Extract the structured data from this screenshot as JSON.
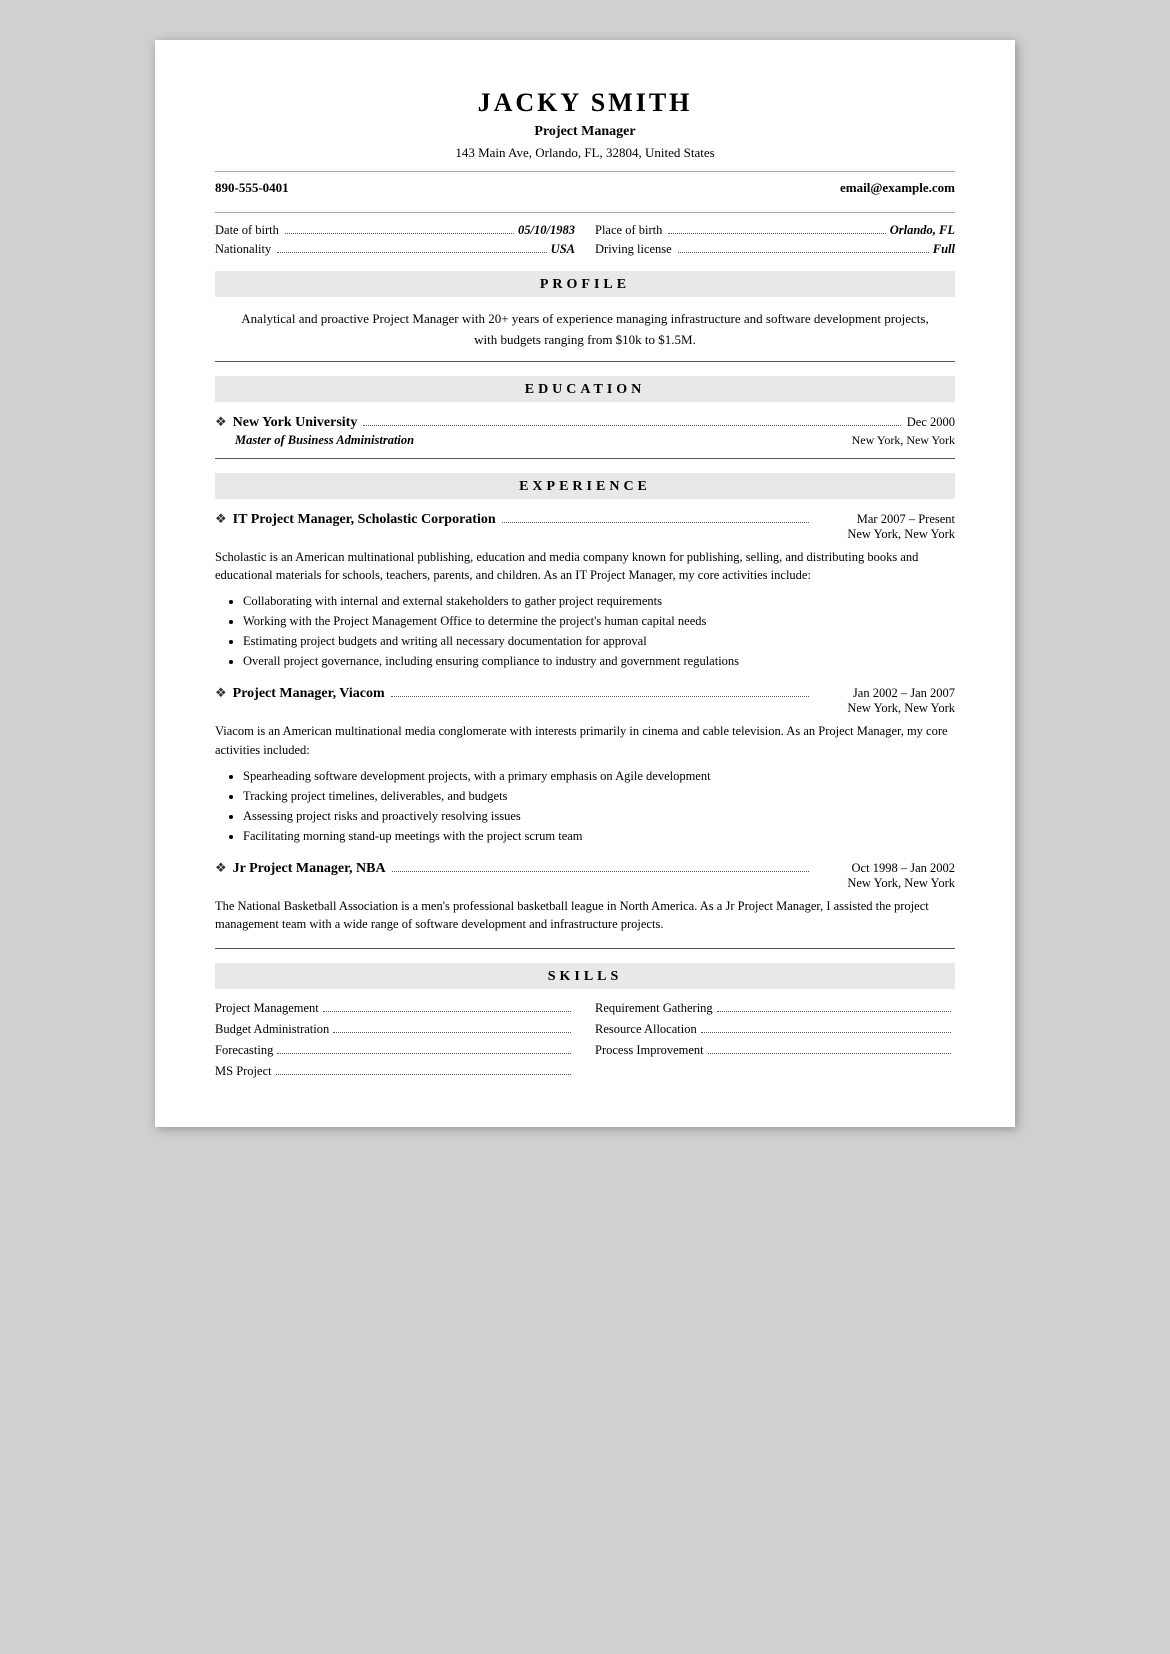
{
  "header": {
    "name": "JACKY SMITH",
    "title": "Project Manager",
    "address": "143 Main Ave, Orlando, FL, 32804, United States",
    "phone": "890-555-0401",
    "email": "email@example.com"
  },
  "personal_info": {
    "dob_label": "Date of birth",
    "dob_value": "05/10/1983",
    "pob_label": "Place of birth",
    "pob_value": "Orlando, FL",
    "nationality_label": "Nationality",
    "nationality_value": "USA",
    "license_label": "Driving license",
    "license_value": "Full"
  },
  "sections": {
    "profile": "PROFILE",
    "profile_text": "Analytical and proactive Project Manager with 20+ years of experience managing infrastructure and software development projects, with budgets ranging from $10k to $1.5M.",
    "education": "EDUCATION",
    "experience": "EXPERIENCE",
    "skills": "SKILLS"
  },
  "education": [
    {
      "school": "New York University",
      "degree": "Master of Business Administration",
      "date": "Dec 2000",
      "location": "New York, New York"
    }
  ],
  "experience": [
    {
      "title": "IT Project Manager, Scholastic Corporation",
      "date": "Mar 2007 – Present",
      "location": "New York, New York",
      "description": "Scholastic is an American multinational publishing, education and media company known for publishing, selling, and distributing books and educational materials for schools, teachers, parents, and children. As an IT Project Manager, my core activities include:",
      "bullets": [
        "Collaborating with internal and external stakeholders to gather project requirements",
        "Working with the Project Management Office to determine the project's human capital needs",
        "Estimating project budgets and writing all necessary documentation for approval",
        "Overall project governance, including ensuring compliance to industry and government regulations"
      ]
    },
    {
      "title": "Project Manager, Viacom",
      "date": "Jan 2002 – Jan 2007",
      "location": "New York, New York",
      "description": "Viacom is an American multinational media conglomerate with interests primarily in cinema and cable television. As an Project Manager, my core activities included:",
      "bullets": [
        "Spearheading software development projects, with a primary emphasis on Agile development",
        "Tracking project timelines, deliverables, and budgets",
        "Assessing project risks and proactively resolving issues",
        "Facilitating morning stand-up meetings with the project scrum team"
      ]
    },
    {
      "title": "Jr Project Manager, NBA",
      "date": "Oct 1998 – Jan 2002",
      "location": "New York, New York",
      "description": "The National Basketball Association is a men's professional basketball league in North America. As a Jr Project Manager, I assisted the project management team with a wide range of software development and infrastructure projects.",
      "bullets": []
    }
  ],
  "skills": [
    {
      "left": "Project Management",
      "right": "Requirement Gathering"
    },
    {
      "left": "Budget Administration",
      "right": "Resource Allocation"
    },
    {
      "left": "Forecasting",
      "right": "Process Improvement"
    },
    {
      "left": "MS Project",
      "right": ""
    }
  ]
}
